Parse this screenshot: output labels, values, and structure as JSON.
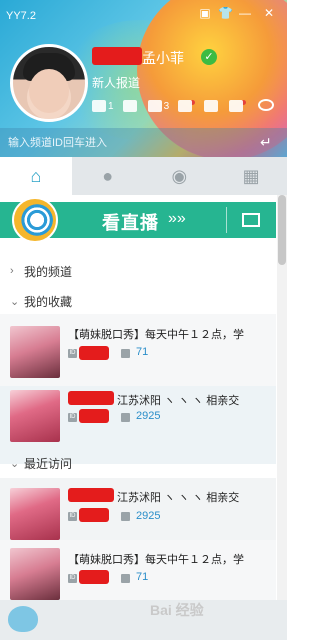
{
  "window": {
    "title": "YY7.2"
  },
  "profile": {
    "name_suffix": "孟小菲",
    "signature": "新人报道",
    "stats": [
      "1",
      "3",
      "",
      ""
    ]
  },
  "search": {
    "placeholder": "输入频道ID回车进入"
  },
  "tabs": [
    {
      "name": "home",
      "icon": "home-icon"
    },
    {
      "name": "friends",
      "icon": "person-icon"
    },
    {
      "name": "groups",
      "icon": "group-icon"
    },
    {
      "name": "apps",
      "icon": "grid-icon"
    }
  ],
  "live": {
    "label": "看直播",
    "arrow": "»»"
  },
  "sections": {
    "my_channels": "我的频道",
    "favorites": "我的收藏",
    "recent": "最近访问"
  },
  "favorites": [
    {
      "title": "【萌妹脱口秀】每天中午１２点，学",
      "count": "71"
    },
    {
      "title": "江苏沭阳 ヽ ヽ ヽ 相亲交",
      "count": "2925"
    }
  ],
  "recent": [
    {
      "title": "江苏沭阳 ヽ ヽ ヽ 相亲交",
      "count": "2925"
    },
    {
      "title": "【萌妹脱口秀】每天中午１２点，学",
      "count": "71"
    }
  ],
  "watermark": "Bai 经验",
  "colors": {
    "accent": "#26b591",
    "link": "#2a8ec9",
    "redact": "#e41c1c"
  }
}
